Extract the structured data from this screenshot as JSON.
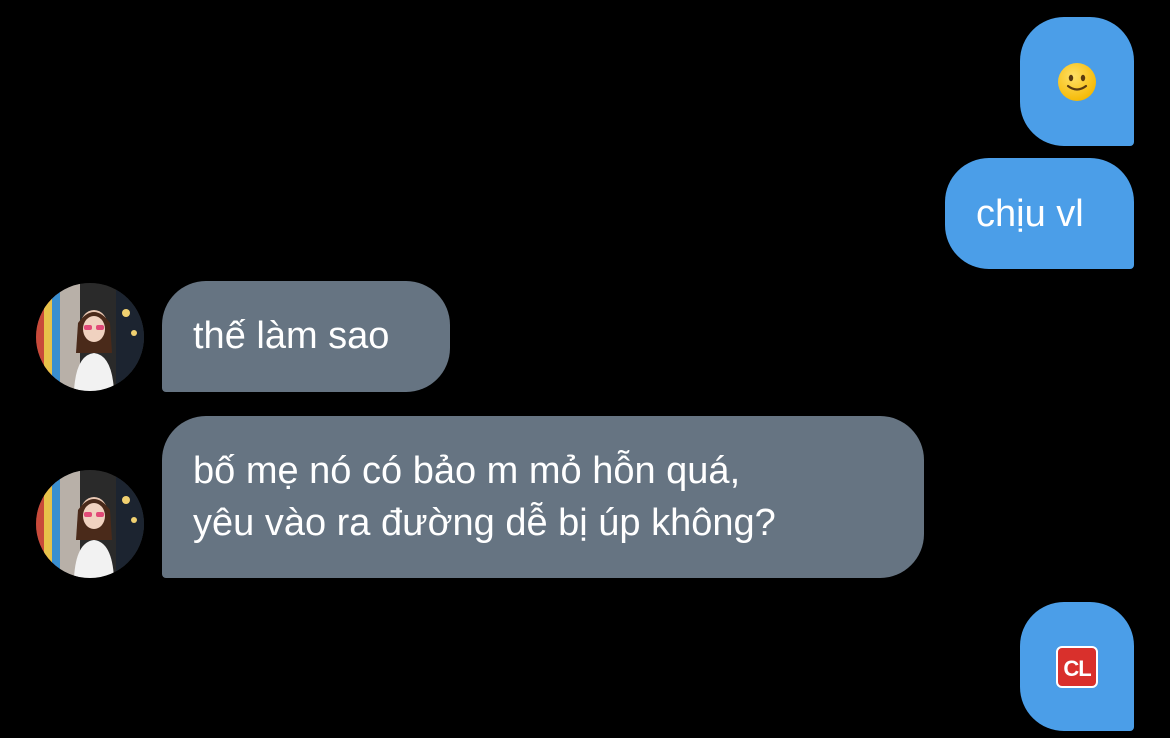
{
  "conversation": {
    "messages": [
      {
        "direction": "outgoing",
        "type": "emoji",
        "icon": "slightly-smiling-face-icon"
      },
      {
        "direction": "outgoing",
        "type": "text",
        "text": "chịu vl"
      },
      {
        "direction": "incoming",
        "type": "text",
        "text": "thế làm sao"
      },
      {
        "direction": "incoming",
        "type": "text",
        "lines": [
          "bố mẹ nó có bảo m mỏ hỗn quá,",
          "yêu vào ra đường dễ bị úp không?"
        ]
      },
      {
        "direction": "outgoing",
        "type": "emoji",
        "icon": "cl-button-icon",
        "glyph": "CL"
      }
    ]
  },
  "colors": {
    "background": "#000000",
    "outgoing_bubble": "#4b9ee8",
    "incoming_bubble": "#667482",
    "text": "#ffffff"
  }
}
